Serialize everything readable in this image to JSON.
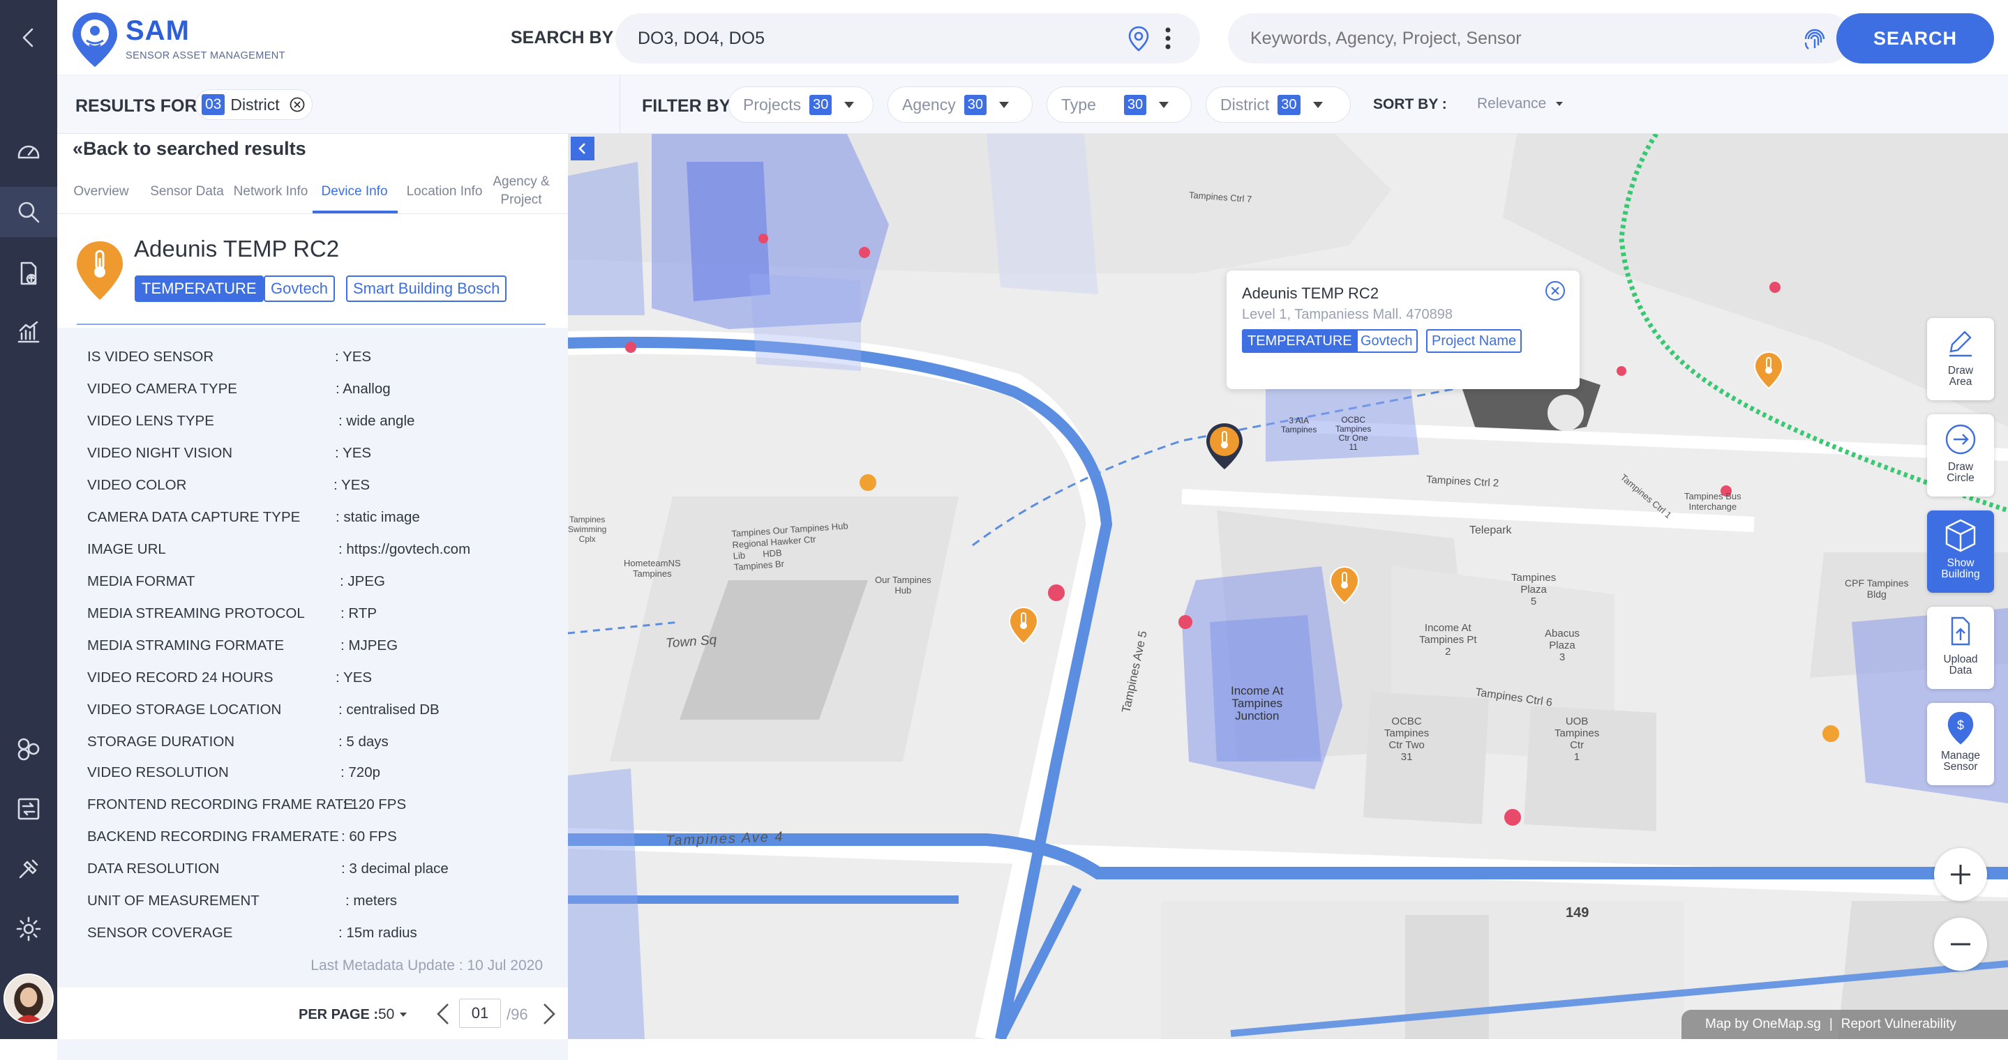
{
  "app": {
    "name": "SAM",
    "subtitle": "SENSOR ASSET MANAGEMENT"
  },
  "header": {
    "search_by_label": "SEARCH BY",
    "search_by_value": "DO3, DO4, DO5",
    "keyword_placeholder": "Keywords, Agency, Project, Sensor",
    "search_button": "SEARCH"
  },
  "filterbar": {
    "results_for_label": "RESULTS FOR",
    "district_badge_num": "03",
    "district_badge_text": "District",
    "filter_by_label": "FILTER BY",
    "filters": [
      {
        "label": "Projects",
        "count": "30"
      },
      {
        "label": "Agency",
        "count": "30"
      },
      {
        "label": "Type",
        "count": "30"
      },
      {
        "label": "District",
        "count": "30"
      }
    ],
    "sort_label": "SORT BY :",
    "sort_value": "Relevance"
  },
  "panel": {
    "back_label": "«Back to searched results",
    "tabs": [
      "Overview",
      "Sensor Data",
      "Network Info",
      "Device Info",
      "Location Info",
      "Agency & Project"
    ],
    "active_tab": "Device Info",
    "device_name": "Adeunis TEMP RC2",
    "tags": [
      "TEMPERATURE",
      "Govtech",
      "Smart Building Bosch"
    ],
    "rows": [
      {
        "k": "IS VIDEO SENSOR",
        "v": ": YES"
      },
      {
        "k": "VIDEO CAMERA TYPE",
        "v": ": Anallog"
      },
      {
        "k": "VIDEO LENS TYPE",
        "v": ": wide angle"
      },
      {
        "k": "VIDEO NIGHT VISION",
        "v": ": YES"
      },
      {
        "k": "VIDEO COLOR",
        "v": ": YES"
      },
      {
        "k": "CAMERA DATA CAPTURE TYPE",
        "v": ": static image"
      },
      {
        "k": "IMAGE URL",
        "v": ": https://govtech.com"
      },
      {
        "k": "MEDIA FORMAT",
        "v": ": JPEG"
      },
      {
        "k": "MEDIA STREAMING PROTOCOL",
        "v": ": RTP"
      },
      {
        "k": "MEDIA STRAMING FORMATE",
        "v": ": MJPEG"
      },
      {
        "k": "VIDEO RECORD 24 HOURS",
        "v": ": YES"
      },
      {
        "k": "VIDEO STORAGE LOCATION",
        "v": ": centralised DB"
      },
      {
        "k": "STORAGE DURATION",
        "v": ": 5 days"
      },
      {
        "k": "VIDEO RESOLUTION",
        "v": ": 720p"
      },
      {
        "k": "FRONTEND RECORDING FRAME RATE",
        "v": ": 120 FPS"
      },
      {
        "k": "BACKEND RECORDING FRAMERATE",
        "v": ": 60 FPS"
      },
      {
        "k": "DATA RESOLUTION",
        "v": ": 3 decimal place"
      },
      {
        "k": "UNIT OF MEASUREMENT",
        "v": ": meters"
      },
      {
        "k": "SENSOR COVERAGE",
        "v": ": 15m radius"
      }
    ],
    "last_update": "Last Metadata Update : 10 Jul 2020",
    "pagination": {
      "per_page_label": "PER PAGE :",
      "per_page_value": "50",
      "page": "01",
      "total": "/96"
    }
  },
  "map": {
    "popup": {
      "title": "Adeunis TEMP RC2",
      "address": "Level 1, Tampaniess Mall. 470898",
      "tags": [
        "TEMPERATURE",
        "Govtech",
        "Project Name"
      ]
    },
    "labels": {
      "ave5": "Tampines Ave 5",
      "ave4": "Tampines Ave 4",
      "ctrl6": "Tampines Ctrl 6",
      "ctrl2": "Tampines Ctrl 2",
      "ctrl1": "Tampines Ctrl 1",
      "ctrl7": "Tampines Ctrl 7",
      "town_sq": "Town Sq",
      "income": "Income At\nTampines\nJunction",
      "income_pt": "Income At\nTampines Pt\n2",
      "abacus": "Abacus\nPlaza\n3",
      "ocbc": "OCBC\nTampines\nCtr Two\n31",
      "uob": "UOB\nTampines\nCtr\n1",
      "plaza": "Tampines\nPlaza\n5",
      "telepark": "Telepark",
      "num149": "149",
      "cpf": "CPF Tampines\nBldg",
      "bus": "Tampines Bus\nInterchange",
      "hub": "Our Tampines\nHub",
      "lib": "Tampines Our Tampines Hub\nRegional Hawker Ctr\nLib       HDB\nTampines Br",
      "home": "HometeamNS\nTampines",
      "swim": "Tampines\nSwimming\nCplx",
      "aia": "3 AIA\nTampines",
      "ocbc_ctr": "OCBC\nTampines\nCtr One\n11"
    },
    "tools": [
      {
        "label": "Draw\nArea",
        "icon": "pencil-icon"
      },
      {
        "label": "Draw\nCircle",
        "icon": "arrow-circle-icon"
      },
      {
        "label": "Show\nBuilding",
        "icon": "cube-icon"
      },
      {
        "label": "Upload\nData",
        "icon": "upload-file-icon"
      },
      {
        "label": "Manage\nSensor",
        "icon": "dollar-pin-icon"
      }
    ],
    "attribution": "Map by OneMap.sg",
    "report": "Report Vulnerability"
  },
  "colors": {
    "accent": "#3e6fe2",
    "sidebar": "#2d3449",
    "pin": "#ef9a2f",
    "road": "#5b8ee0"
  }
}
